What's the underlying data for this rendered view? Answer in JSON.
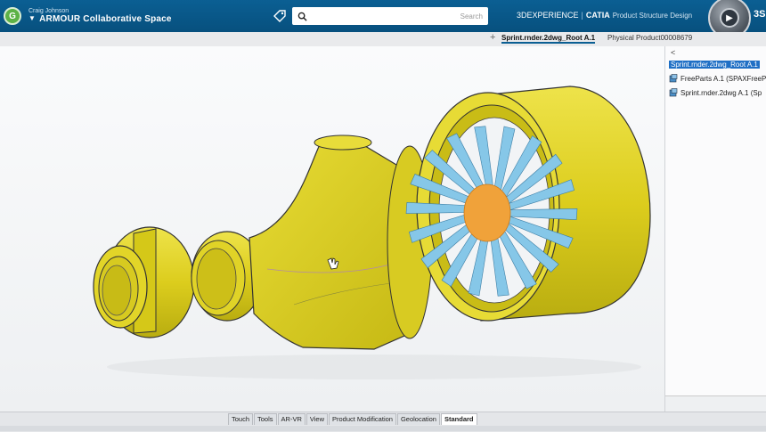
{
  "header": {
    "user_name": "Craig Johnson",
    "space_name": "ARMOUR Collaborative Space",
    "avatar_initial": "G",
    "search_placeholder": "Search",
    "brand_3d": "3DEXPERIENCE",
    "brand_app": "CATIA",
    "brand_role": "Product Structure Design",
    "ds_logo": "3S"
  },
  "tabs": [
    {
      "label": "Physical Product00008679",
      "active": false
    },
    {
      "label": "Sprint.rnder.2dwg_Root A.1",
      "active": true
    }
  ],
  "tab_plus": "+",
  "tree": {
    "toggle": "<",
    "items": [
      {
        "label": "Sprint.rnder.2dwg_Root A.1",
        "selected": true,
        "icon": "assembly-icon"
      },
      {
        "label": "FreeParts A.1 (SPAXFreeP",
        "selected": false,
        "icon": "part-icon"
      },
      {
        "label": "Sprint.rnder.2dwg A.1 (Sp",
        "selected": false,
        "icon": "part-icon"
      }
    ]
  },
  "bottom_tabs": [
    "Standard",
    "Geolocation",
    "Product Modification",
    "View",
    "AR-VR",
    "Tools",
    "Touch"
  ],
  "colors": {
    "topbar": "#0b5f93",
    "part_yellow": "#e2d420",
    "fan_blue": "#7ec3e8",
    "hub_orange": "#f0a33a"
  }
}
